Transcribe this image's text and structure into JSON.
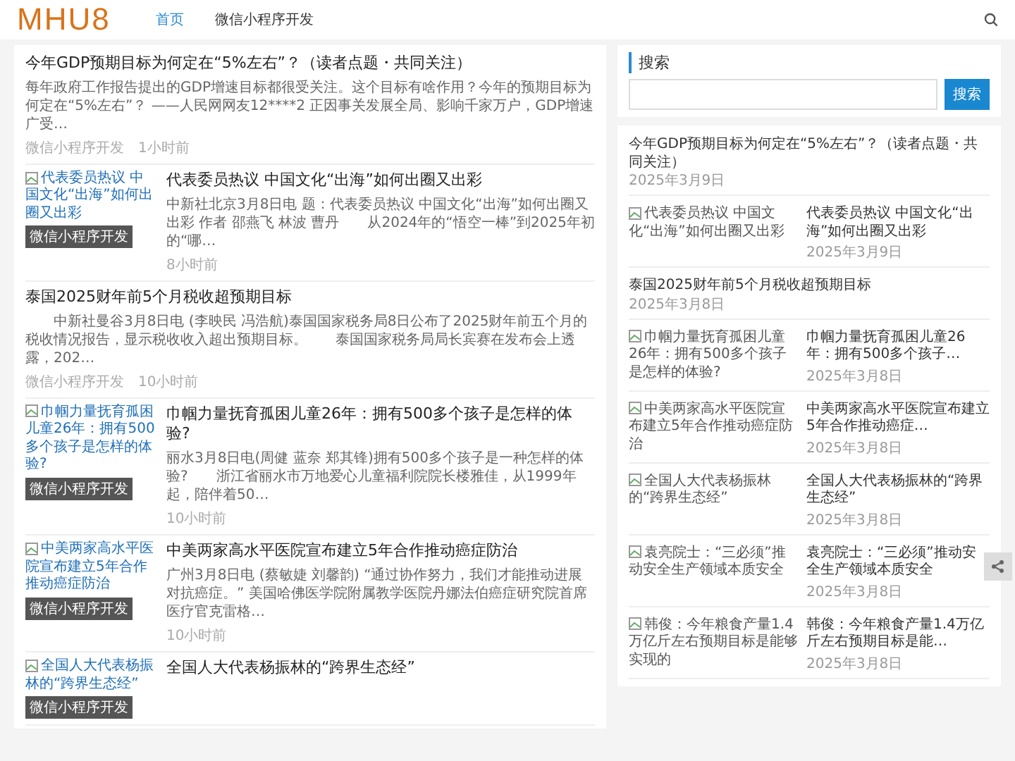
{
  "header": {
    "logo": "MHU8",
    "nav": [
      {
        "label": "首页",
        "selected": true
      },
      {
        "label": "微信小程序开发",
        "selected": false
      }
    ]
  },
  "articles": [
    {
      "kind": "text",
      "title": "今年GDP预期目标为何定在“5%左右”？（读者点题・共同关注）",
      "excerpt": "每年政府工作报告提出的GDP增速目标都很受关注。这个目标有啥作用？今年的预期目标为何定在“5%左右”？ ——人民网网友12****2 正因事关发展全局、影响千家万户，GDP增速广受…",
      "category": "微信小程序开发",
      "time": "1小时前"
    },
    {
      "kind": "image",
      "image_alt": "代表委员热议 中国文化“出海”如何出圈又出彩",
      "badge": "微信小程序开发",
      "title": "代表委员热议 中国文化“出海”如何出圈又出彩",
      "excerpt": "中新社北京3月8日电 题：代表委员热议 中国文化“出海”如何出圈又出彩 作者 邵燕飞 林波 曹丹　　从2024年的“悟空一棒”到2025年初的“哪…",
      "time": "8小时前"
    },
    {
      "kind": "text",
      "title": "泰国2025财年前5个月税收超预期目标",
      "excerpt": "　　中新社曼谷3月8日电 (李映民 冯浩航)泰国国家税务局8日公布了2025财年前五个月的税收情况报告，显示税收收入超出预期目标。　　泰国国家税务局局长宾赛在发布会上透露，202…",
      "category": "微信小程序开发",
      "time": "10小时前"
    },
    {
      "kind": "image",
      "image_alt": "巾帼力量抚育孤困儿童26年：拥有500多个孩子是怎样的体验?",
      "badge": "微信小程序开发",
      "title": "巾帼力量抚育孤困儿童26年：拥有500多个孩子是怎样的体验?",
      "excerpt": "丽水3月8日电(周健 蓝奈 郑其锋)拥有500多个孩子是一种怎样的体验?　　浙江省丽水市万地爱心儿童福利院院长楼雅佳，从1999年起，陪伴着50…",
      "time": "10小时前"
    },
    {
      "kind": "image",
      "image_alt": "中美两家高水平医院宣布建立5年合作推动癌症防治",
      "badge": "微信小程序开发",
      "title": "中美两家高水平医院宣布建立5年合作推动癌症防治",
      "excerpt": "广州3月8日电 (蔡敏婕 刘馨韵) “通过协作努力，我们才能推动进展对抗癌症。” 美国哈佛医学院附属教学医院丹娜法伯癌症研究院首席医疗官克雷格…",
      "time": "10小时前"
    },
    {
      "kind": "image",
      "image_alt": "全国人大代表杨振林的“跨界生态经”",
      "badge": "微信小程序开发",
      "title": "全国人大代表杨振林的“跨界生态经”"
    }
  ],
  "sidebar": {
    "search": {
      "heading": "搜索",
      "button": "搜索"
    },
    "items": [
      {
        "kind": "text",
        "title": "今年GDP预期目标为何定在“5%左右”？（读者点题・共同关注）",
        "date": "2025年3月9日"
      },
      {
        "kind": "image",
        "image_alt": "代表委员热议 中国文化“出海”如何出圈又出彩",
        "title": "代表委员热议 中国文化“出海”如何出圈又出彩",
        "date": "2025年3月9日"
      },
      {
        "kind": "text",
        "title": "泰国2025财年前5个月税收超预期目标",
        "date": "2025年3月8日"
      },
      {
        "kind": "image",
        "image_alt": "巾帼力量抚育孤困儿童26年：拥有500多个孩子是怎样的体验?",
        "title": "巾帼力量抚育孤困儿童26年：拥有500多个孩子…",
        "date": "2025年3月8日"
      },
      {
        "kind": "image",
        "image_alt": "中美两家高水平医院宣布建立5年合作推动癌症防治",
        "title": "中美两家高水平医院宣布建立5年合作推动癌症…",
        "date": "2025年3月8日"
      },
      {
        "kind": "image",
        "image_alt": "全国人大代表杨振林的“跨界生态经”",
        "title": "全国人大代表杨振林的“跨界生态经”",
        "date": "2025年3月8日"
      },
      {
        "kind": "image",
        "image_alt": "袁亮院士：“三必须”推动安全生产领域本质安全",
        "title": "袁亮院士：“三必须”推动安全生产领域本质安全",
        "date": "2025年3月8日"
      },
      {
        "kind": "image",
        "image_alt": "韩俊：今年粮食产量1.4万亿斤左右预期目标是能够实现的",
        "title": "韩俊：今年粮食产量1.4万亿斤左右预期目标是能…",
        "date": "2025年3月8日"
      }
    ]
  }
}
